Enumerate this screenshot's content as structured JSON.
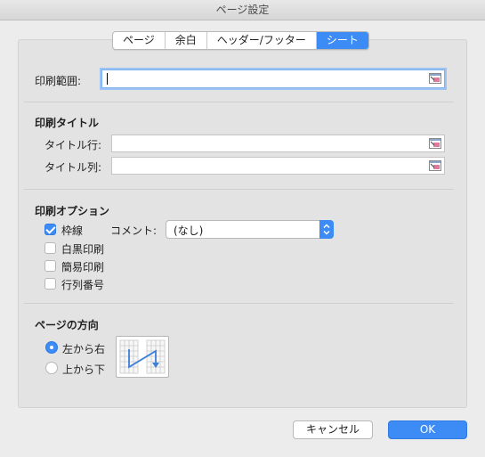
{
  "window": {
    "title": "ページ設定"
  },
  "tabs": [
    {
      "label": "ページ"
    },
    {
      "label": "余白"
    },
    {
      "label": "ヘッダー/フッター"
    },
    {
      "label": "シート",
      "active": true
    }
  ],
  "print_area": {
    "label": "印刷範囲:",
    "value": ""
  },
  "print_titles": {
    "heading": "印刷タイトル",
    "rows_label": "タイトル行:",
    "rows_value": "",
    "cols_label": "タイトル列:",
    "cols_value": ""
  },
  "print_options": {
    "heading": "印刷オプション",
    "gridlines": {
      "label": "枠線",
      "checked": true
    },
    "bw": {
      "label": "白黒印刷",
      "checked": false
    },
    "draft": {
      "label": "簡易印刷",
      "checked": false
    },
    "headings": {
      "label": "行列番号",
      "checked": false
    },
    "comments_label": "コメント:",
    "comments_value": "(なし)"
  },
  "page_order": {
    "heading": "ページの方向",
    "across": {
      "label": "左から右",
      "selected": true
    },
    "down": {
      "label": "上から下",
      "selected": false
    }
  },
  "buttons": {
    "cancel": "キャンセル",
    "ok": "OK"
  },
  "colors": {
    "accent": "#3d8cf5"
  }
}
